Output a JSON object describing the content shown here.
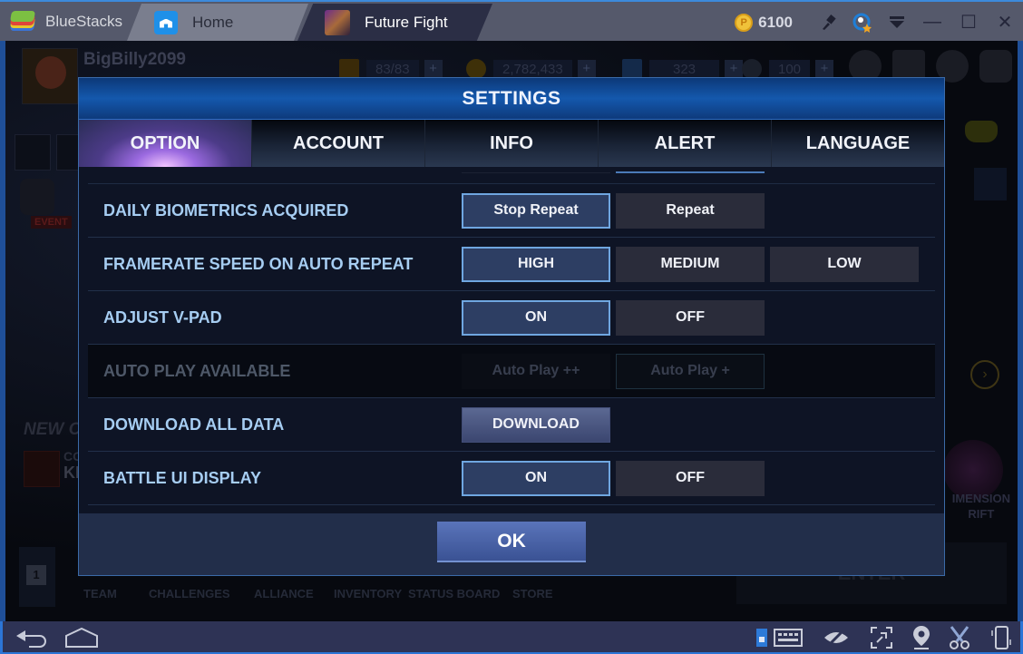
{
  "titlebar": {
    "app_name": "BlueStacks",
    "tabs": [
      {
        "label": "Home",
        "icon": "home-icon",
        "active": false
      },
      {
        "label": "Future Fight",
        "icon": "future-fight-game-icon",
        "active": true
      }
    ],
    "coins": "6100",
    "coin_icon_glyph": "P",
    "icons": [
      "paintbrush-icon",
      "account-star-icon",
      "menu-dropdown-icon"
    ],
    "window_controls": {
      "minimize": "—",
      "maximize": "☐",
      "close": "✕"
    }
  },
  "game_background": {
    "player_name": "BigBilly2099",
    "resources": [
      {
        "name": "energy",
        "value": "83/83"
      },
      {
        "name": "gold",
        "value": "2,782,433"
      },
      {
        "name": "crystals",
        "value": "323"
      },
      {
        "name": "fire",
        "value": "100"
      }
    ],
    "plus_label": "+",
    "event_label": "EVENT",
    "new_challenge": "NEW CH",
    "kil_co": "CO",
    "kil_text": "KIL",
    "slot_number": "1",
    "bottom_nav": [
      "TEAM",
      "CHALLENGES",
      "ALLIANCE",
      "INVENTORY",
      "STATUS BOARD",
      "STORE"
    ],
    "dimension_rift": "IMENSION\nRIFT",
    "enter_label": "ENTER",
    "arrow_glyph": "›"
  },
  "dialog": {
    "title": "SETTINGS",
    "tabs": [
      {
        "label": "OPTION",
        "active": true
      },
      {
        "label": "ACCOUNT",
        "active": false
      },
      {
        "label": "INFO",
        "active": false
      },
      {
        "label": "ALERT",
        "active": false
      },
      {
        "label": "LANGUAGE",
        "active": false
      }
    ],
    "rows": [
      {
        "label": "DAILY BIOMETRICS ACQUIRED",
        "options": [
          "Stop Repeat",
          "Repeat"
        ],
        "selected": "Stop Repeat",
        "enabled": true
      },
      {
        "label": "FRAMERATE SPEED ON AUTO REPEAT",
        "options": [
          "HIGH",
          "MEDIUM",
          "LOW"
        ],
        "selected": "HIGH",
        "enabled": true
      },
      {
        "label": "ADJUST V-PAD",
        "options": [
          "ON",
          "OFF"
        ],
        "selected": "ON",
        "enabled": true
      },
      {
        "label": "AUTO PLAY AVAILABLE",
        "options": [
          "Auto Play ++",
          "Auto Play +"
        ],
        "selected": "Auto Play +",
        "enabled": false
      },
      {
        "label": "DOWNLOAD ALL DATA",
        "options": [
          "DOWNLOAD"
        ],
        "selected": null,
        "enabled": true
      },
      {
        "label": "BATTLE UI DISPLAY",
        "options": [
          "ON",
          "OFF"
        ],
        "selected": "ON",
        "enabled": true
      }
    ],
    "ok_label": "OK"
  },
  "android_bar": {
    "left": [
      "back-icon",
      "home-icon"
    ],
    "right": [
      "keyboard-mapping-icon",
      "eye-hidden-icon",
      "fullscreen-icon",
      "location-icon",
      "scissors-icon",
      "rotate-device-icon"
    ]
  }
}
